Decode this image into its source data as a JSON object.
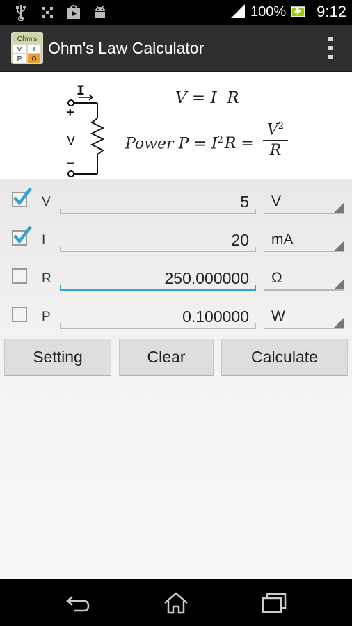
{
  "status_bar": {
    "battery_percent": "100%",
    "time": "9:12",
    "icons": [
      "usb-icon",
      "sim-icon",
      "play-store-icon",
      "android-debug-icon",
      "signal-icon",
      "battery-icon"
    ]
  },
  "action_bar": {
    "title": "Ohm's Law Calculator",
    "app_icon_text": "Ohm's",
    "app_icon_cells": [
      "V",
      "I",
      "P",
      "Ω"
    ]
  },
  "diagram": {
    "current_label": "I",
    "plus": "+",
    "voltage_label": "V",
    "minus": "−"
  },
  "formulas": {
    "line1": "V = I  R",
    "power_word": "Power ",
    "line2_rest": "P = I",
    "sup2": "2",
    "r_eq": "R =",
    "frac_num": "V",
    "frac_den": "R"
  },
  "rows": [
    {
      "label": "V",
      "checked": true,
      "value": "5",
      "unit": "V"
    },
    {
      "label": "I",
      "checked": true,
      "value": "20",
      "unit": "mA"
    },
    {
      "label": "R",
      "checked": false,
      "value": "250.000000",
      "unit": "Ω"
    },
    {
      "label": "P",
      "checked": false,
      "value": "0.100000",
      "unit": "W"
    }
  ],
  "buttons": {
    "setting": "Setting",
    "clear": "Clear",
    "calculate": "Calculate"
  },
  "colors": {
    "accent": "#33a3d6",
    "checkmark": "#33a3d6",
    "battery": "#99cc00",
    "action_bar": "#2f2f2f"
  }
}
